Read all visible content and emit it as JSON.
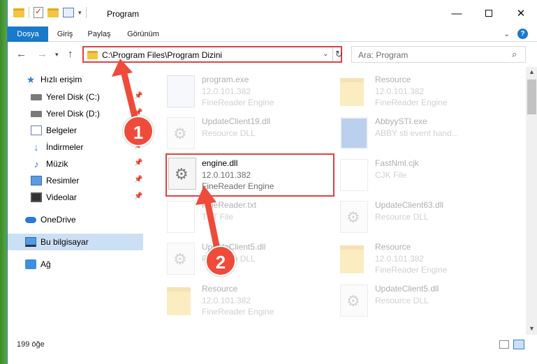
{
  "window": {
    "title": "Program",
    "controls": {
      "minimize": "—",
      "maximize": "",
      "close": "✕"
    }
  },
  "ribbon": {
    "tabs": [
      "Dosya",
      "Giriş",
      "Paylaş",
      "Görünüm"
    ],
    "help": "?"
  },
  "nav": {
    "address": "C:\\Program Files\\Program Dizini",
    "search_placeholder": "Ara: Program"
  },
  "sidebar": {
    "items": [
      {
        "label": "Hızlı erişim",
        "icon": "star-icon",
        "pinned": false
      },
      {
        "label": "Yerel Disk (C:)",
        "icon": "drive-icon",
        "pinned": true
      },
      {
        "label": "Yerel Disk (D:)",
        "icon": "drive-icon",
        "pinned": true
      },
      {
        "label": "Belgeler",
        "icon": "documents-icon",
        "pinned": true
      },
      {
        "label": "İndirmeler",
        "icon": "downloads-icon",
        "pinned": true
      },
      {
        "label": "Müzik",
        "icon": "music-icon",
        "pinned": true
      },
      {
        "label": "Resimler",
        "icon": "pictures-icon",
        "pinned": true
      },
      {
        "label": "Videolar",
        "icon": "videos-icon",
        "pinned": true
      },
      {
        "label": "OneDrive",
        "icon": "onedrive-icon",
        "pinned": false
      },
      {
        "label": "Bu bilgisayar",
        "icon": "computer-icon",
        "pinned": false,
        "selected": true
      },
      {
        "label": "Ağ",
        "icon": "network-icon",
        "pinned": false
      }
    ]
  },
  "files": [
    {
      "name": "program.exe",
      "line1": "12.0.101.382",
      "line2": "FineReader Engine",
      "icon": "exe-icon"
    },
    {
      "name": "Resource",
      "line1": "12.0.101.382",
      "line2": "FineReader Engine",
      "icon": "folder-icon"
    },
    {
      "name": "UpdateClient19.dll",
      "line1": "Resource DLL",
      "line2": "",
      "icon": "dll-icon"
    },
    {
      "name": "AbbyySTI.exe",
      "line1": "ABBY sti event hand...",
      "line2": "",
      "icon": "exe-icon"
    },
    {
      "name": "engine.dll",
      "line1": "12.0.101.382",
      "line2": "FineReader Engine",
      "icon": "dll-icon",
      "highlighted": true
    },
    {
      "name": "FastNml.cjk",
      "line1": "CJK File",
      "line2": "",
      "icon": "file-icon"
    },
    {
      "name": "FineReader.txt",
      "line1": "TXT File",
      "line2": "",
      "icon": "text-file-icon"
    },
    {
      "name": "UpdateClient63.dll",
      "line1": "Resource DLL",
      "line2": "",
      "icon": "dll-icon"
    },
    {
      "name": "UpdateClient5.dll",
      "line1": "Resource DLL",
      "line2": "",
      "icon": "dll-icon"
    },
    {
      "name": "Resource",
      "line1": "12.0.101.382",
      "line2": "FineReader Engine",
      "icon": "folder-icon"
    },
    {
      "name": "Resource",
      "line1": "12.0.101.382",
      "line2": "FineReader Engine",
      "icon": "folder-icon"
    },
    {
      "name": "UpdateClient5.dll",
      "line1": "Resource DLL",
      "line2": "",
      "icon": "dll-icon"
    }
  ],
  "status": {
    "count": "199 öğe"
  },
  "annotations": {
    "badge1": "1",
    "badge2": "2",
    "color": "#ef4b3a"
  }
}
